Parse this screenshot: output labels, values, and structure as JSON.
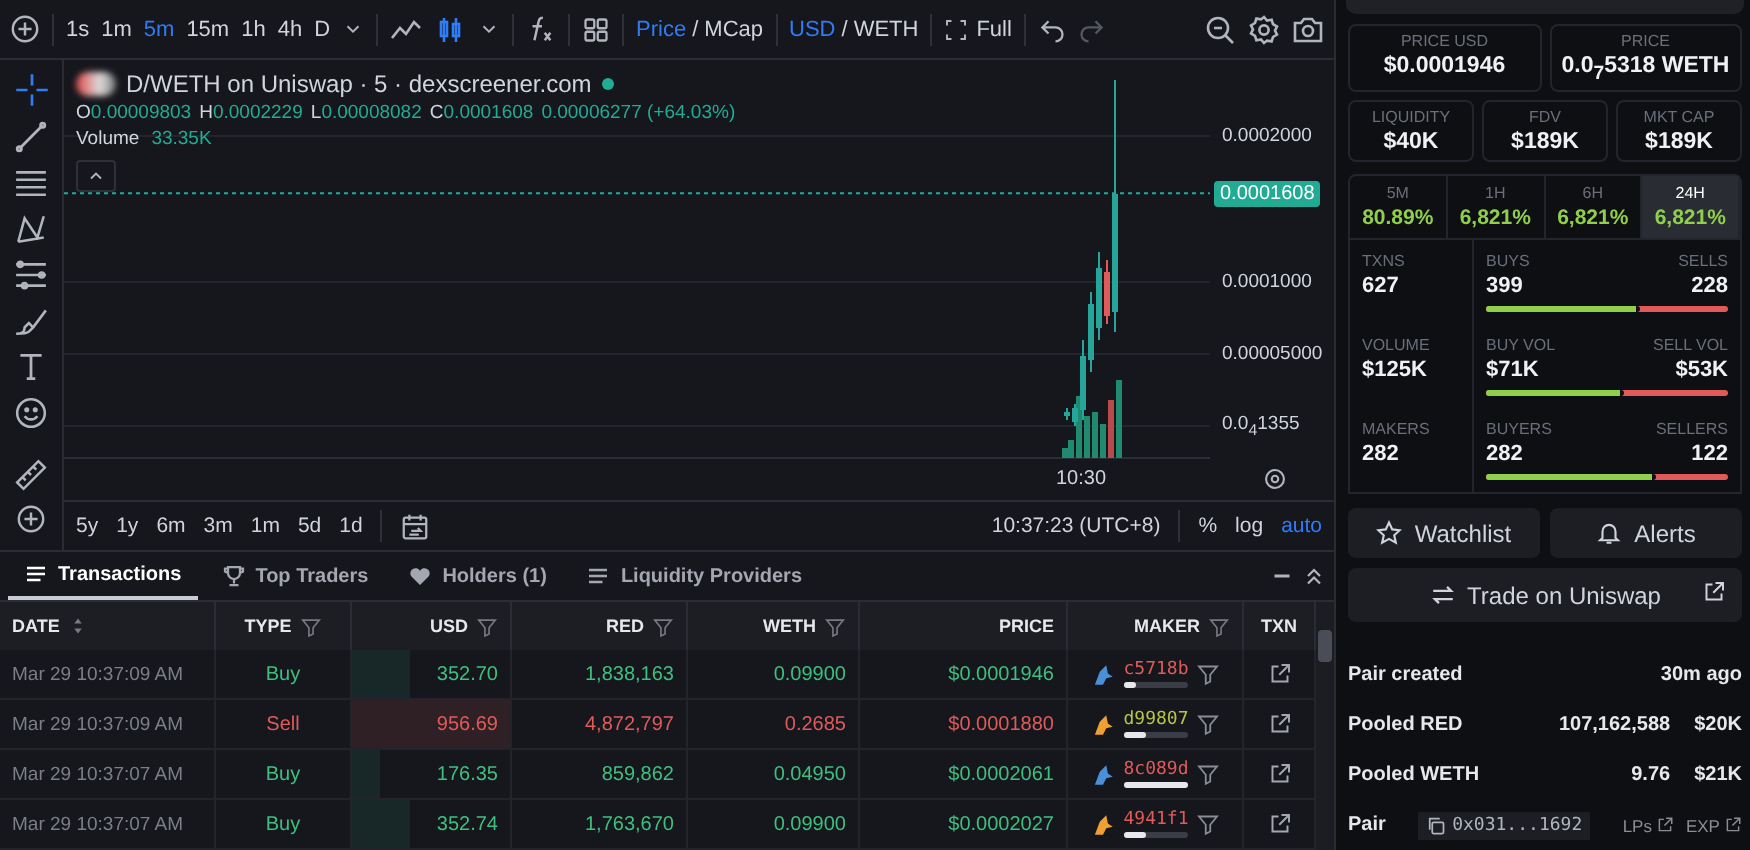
{
  "toolbar": {
    "intervals": [
      {
        "label": "1s",
        "selected": false
      },
      {
        "label": "1m",
        "selected": false
      },
      {
        "label": "5m",
        "selected": true
      },
      {
        "label": "15m",
        "selected": false
      },
      {
        "label": "1h",
        "selected": false
      },
      {
        "label": "4h",
        "selected": false
      },
      {
        "label": "D",
        "selected": false
      }
    ],
    "price_toggle": {
      "separator": "/",
      "options": [
        {
          "label": "Price",
          "selected": true
        },
        {
          "label": "MCap",
          "selected": false
        }
      ]
    },
    "currency_toggle": {
      "separator": "/",
      "options": [
        {
          "label": "USD",
          "selected": true
        },
        {
          "label": "WETH",
          "selected": false
        }
      ]
    },
    "full_label": "Full"
  },
  "chart": {
    "title": "D/WETH on Uniswap · 5 · dexscreener.com",
    "ohlc": [
      {
        "key": "O",
        "value": "0.00009803"
      },
      {
        "key": "H",
        "value": "0.0002229"
      },
      {
        "key": "L",
        "value": "0.00008082"
      },
      {
        "key": "C",
        "value": "0.0001608"
      }
    ],
    "change": "0.00006277 (+64.03%)",
    "volume_label": "Volume",
    "volume_value": "33.35K",
    "price_ticks": [
      "0.0002000",
      "0.0001000",
      "0.00005000",
      "0.0$_{4}$1355"
    ],
    "current_price": "0.0001608",
    "time_label": "10:30"
  },
  "ranges": [
    "5y",
    "1y",
    "6m",
    "3m",
    "1m",
    "5d",
    "1d"
  ],
  "clock": "10:37:23 (UTC+8)",
  "scale_options": [
    {
      "label": "%",
      "selected": false
    },
    {
      "label": "log",
      "selected": false
    },
    {
      "label": "auto",
      "selected": true
    }
  ],
  "table_tabs": [
    {
      "label": "Transactions",
      "kind": "list",
      "selected": true
    },
    {
      "label": "Top Traders",
      "kind": "trophy",
      "selected": false
    },
    {
      "label": "Holders (1)",
      "kind": "heart",
      "selected": false
    },
    {
      "label": "Liquidity Providers",
      "kind": "list",
      "selected": false
    }
  ],
  "table": {
    "columns": [
      {
        "label": "DATE",
        "kind": "sort"
      },
      {
        "label": "TYPE",
        "kind": "filter"
      },
      {
        "label": "USD",
        "kind": "filter"
      },
      {
        "label": "RED",
        "kind": "filter"
      },
      {
        "label": "WETH",
        "kind": "filter"
      },
      {
        "label": "PRICE",
        "kind": "plain"
      },
      {
        "label": "MAKER",
        "kind": "filter"
      },
      {
        "label": "TXN",
        "kind": "plain"
      }
    ],
    "rows": [
      {
        "kind": "buy",
        "date": "Mar 29 10:37:09 AM",
        "type": "Buy",
        "usd": "352.70",
        "level": 0.37,
        "red": "1,838,163",
        "weth": "0.09900",
        "price": "$0.0001946",
        "maker": {
          "address": "c5718b",
          "color": "#e05a5a",
          "level": 0.2
        }
      },
      {
        "kind": "sell",
        "date": "Mar 29 10:37:09 AM",
        "type": "Sell",
        "usd": "956.69",
        "level": 1,
        "red": "4,872,797",
        "weth": "0.2685",
        "price": "$0.0001880",
        "maker": {
          "address": "d99807",
          "color": "#b7c44a",
          "level": 0.35
        }
      },
      {
        "kind": "buy",
        "date": "Mar 29 10:37:07 AM",
        "type": "Buy",
        "usd": "176.35",
        "level": 0.18,
        "red": "859,862",
        "weth": "0.04950",
        "price": "$0.0002061",
        "maker": {
          "address": "8c089d",
          "color": "#e05a5a",
          "level": 1
        }
      },
      {
        "kind": "buy",
        "date": "Mar 29 10:37:07 AM",
        "type": "Buy",
        "usd": "352.74",
        "level": 0.37,
        "red": "1,763,670",
        "weth": "0.09900",
        "price": "$0.0002027",
        "maker": {
          "address": "4941f1",
          "color": "#e05a5a",
          "level": 0.35
        }
      }
    ]
  },
  "stats": {
    "price_cards": [
      {
        "label": "PRICE USD",
        "value": "$0.0001946"
      },
      {
        "label": "PRICE",
        "value": "0.0$_{7}$5318 WETH"
      }
    ],
    "metric_cards": [
      {
        "label": "LIQUIDITY",
        "value": "$40K"
      },
      {
        "label": "FDV",
        "value": "$189K"
      },
      {
        "label": "MKT CAP",
        "value": "$189K"
      }
    ],
    "periods": [
      {
        "label": "5M",
        "change": "80.89%",
        "selected": false
      },
      {
        "label": "1H",
        "change": "6,821%",
        "selected": false
      },
      {
        "label": "6H",
        "change": "6,821%",
        "selected": false
      },
      {
        "label": "24H",
        "change": "6,821%",
        "selected": true
      }
    ],
    "activity": [
      {
        "label": "TXNS",
        "value": "627",
        "left_label": "BUYS",
        "left_value": "399",
        "right_label": "SELLS",
        "right_value": "228",
        "level": 0.64
      },
      {
        "label": "VOLUME",
        "value": "$125K",
        "left_label": "BUY VOL",
        "left_value": "$71K",
        "right_label": "SELL VOL",
        "right_value": "$53K",
        "level": 0.57
      },
      {
        "label": "MAKERS",
        "value": "282",
        "left_label": "BUYERS",
        "left_value": "282",
        "right_label": "SELLERS",
        "right_value": "122",
        "level": 0.7
      }
    ]
  },
  "actions": [
    {
      "label": "Watchlist",
      "kind": "star"
    },
    {
      "label": "Alerts",
      "kind": "bell"
    }
  ],
  "trade_button": "Trade on Uniswap",
  "info": [
    {
      "kind": "text",
      "label": "Pair created",
      "values": [
        "30m ago"
      ]
    },
    {
      "kind": "text",
      "label": "Pooled RED",
      "values": [
        "107,162,588",
        "$20K"
      ]
    },
    {
      "kind": "text",
      "label": "Pooled WETH",
      "values": [
        "9.76",
        "$21K"
      ]
    },
    {
      "kind": "address",
      "label": "Pair",
      "address": "0x031...1692",
      "links": [
        "LPs",
        "EXP"
      ]
    }
  ]
}
